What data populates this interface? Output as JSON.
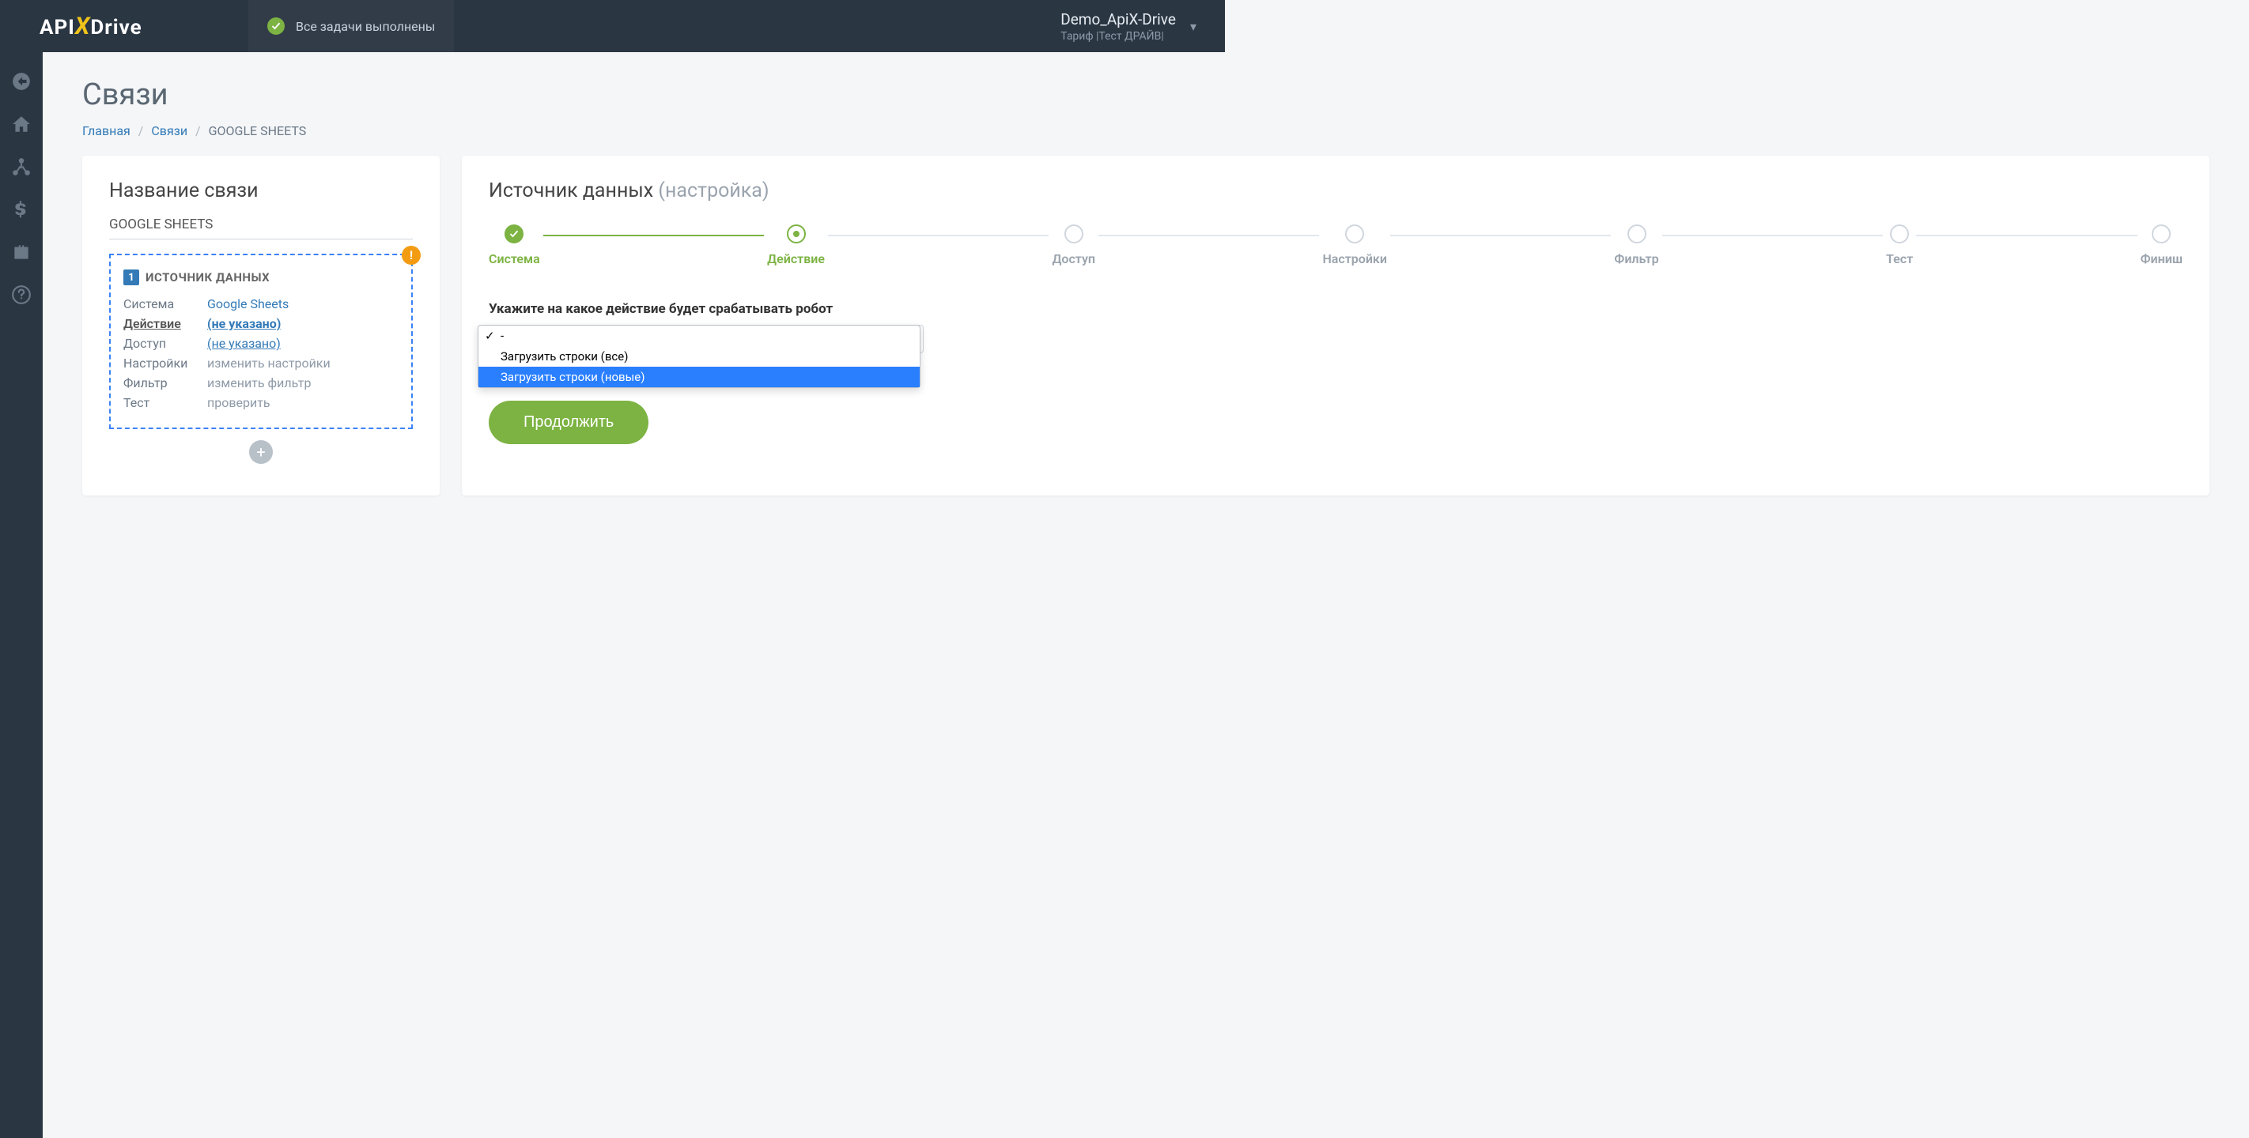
{
  "header": {
    "status_text": "Все задачи выполнены",
    "user_name": "Demo_ApiX-Drive",
    "tariff": "Тариф |Тест ДРАЙВ|"
  },
  "page": {
    "title": "Связи",
    "breadcrumb": {
      "home": "Главная",
      "links": "Связи",
      "current": "GOOGLE SHEETS"
    }
  },
  "left": {
    "heading": "Название связи",
    "conn_name": "GOOGLE SHEETS",
    "source_title": "ИСТОЧНИК ДАННЫХ",
    "source_num": "1",
    "rows": {
      "system_label": "Система",
      "system_val": "Google Sheets",
      "action_label": "Действие",
      "action_val": "(не указано)",
      "access_label": "Доступ",
      "access_val": "(не указано)",
      "settings_label": "Настройки",
      "settings_val": "изменить настройки",
      "filter_label": "Фильтр",
      "filter_val": "изменить фильтр",
      "test_label": "Тест",
      "test_val": "проверить"
    }
  },
  "right": {
    "title_main": "Источник данных ",
    "title_sub": "(настройка)",
    "steps": [
      "Система",
      "Действие",
      "Доступ",
      "Настройки",
      "Фильтр",
      "Тест",
      "Финиш"
    ],
    "field_label": "Укажите на какое действие будет срабатывать робот",
    "select_value": "-",
    "options": [
      "-",
      "Загрузить строки (все)",
      "Загрузить строки (новые)"
    ],
    "continue": "Продолжить"
  }
}
